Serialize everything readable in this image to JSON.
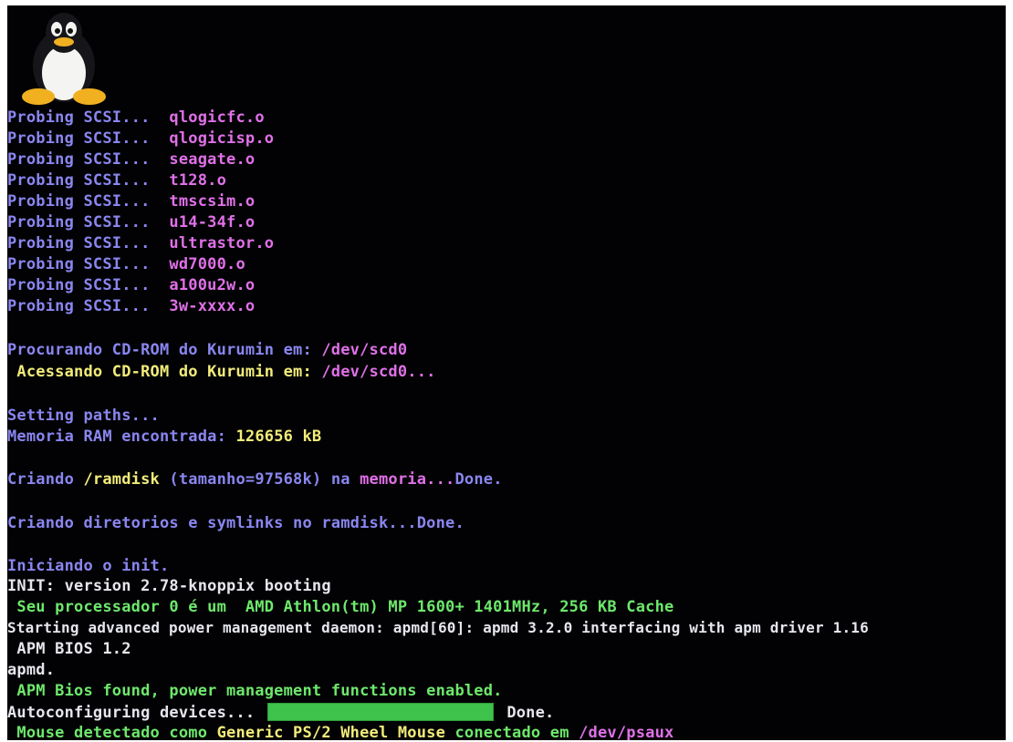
{
  "colors": {
    "background": "#020204",
    "blue": "#8a86f0",
    "magenta": "#e070e8",
    "yellow": "#f2ec7a",
    "green": "#6ee86c",
    "white": "#e6e6ee",
    "progress_fill": "#3fc24c"
  },
  "logo": {
    "icon": "tux-penguin-icon"
  },
  "scsi": {
    "prefix": "Probing SCSI...",
    "modules": [
      "qlogicfc.o",
      "qlogicisp.o",
      "seagate.o",
      "t128.o",
      "tmscsim.o",
      "u14-34f.o",
      "ultrastor.o",
      "wd7000.o",
      "a100u2w.o",
      "3w-xxxx.o"
    ]
  },
  "cdrom": {
    "search_text": "Procurando CD-ROM do Kurumin em:",
    "search_dev": "/dev/scd0",
    "access_text": " Acessando CD-ROM do Kurumin em:",
    "access_dev": "/dev/scd0..."
  },
  "memory": {
    "paths": "Setting paths...",
    "ram_label": "Memoria RAM encontrada:",
    "ram_value": "126656 kB"
  },
  "ramdisk": {
    "prefix": "Criando",
    "path": "/ramdisk",
    "size": "(tamanho=97568k)",
    "on": "na",
    "mem": "memoria...",
    "done": "Done."
  },
  "dirs": {
    "text": "Criando diretorios e symlinks no ramdisk...Done."
  },
  "init": {
    "start": "Iniciando o init.",
    "version": "INIT: version 2.78-knoppix booting",
    "cpu": " Seu processador 0 é um  AMD Athlon(tm) MP 1600+ 1401MHz, 256 KB Cache"
  },
  "apm": {
    "daemon": "Starting advanced power management daemon: apmd[60]: apmd 3.2.0 interfacing with apm driver 1.16",
    "bios": " APM BIOS 1.2",
    "apmd": "apmd.",
    "found": " APM Bios found, power management functions enabled."
  },
  "autoconfig": {
    "label": "Autoconfiguring devices...",
    "progress": 1.0,
    "done": "Done."
  },
  "mouse": {
    "prefix": " Mouse detectado como",
    "model": "Generic PS/2 Wheel Mouse",
    "connected": "conectado em",
    "device": "/dev/psaux"
  }
}
